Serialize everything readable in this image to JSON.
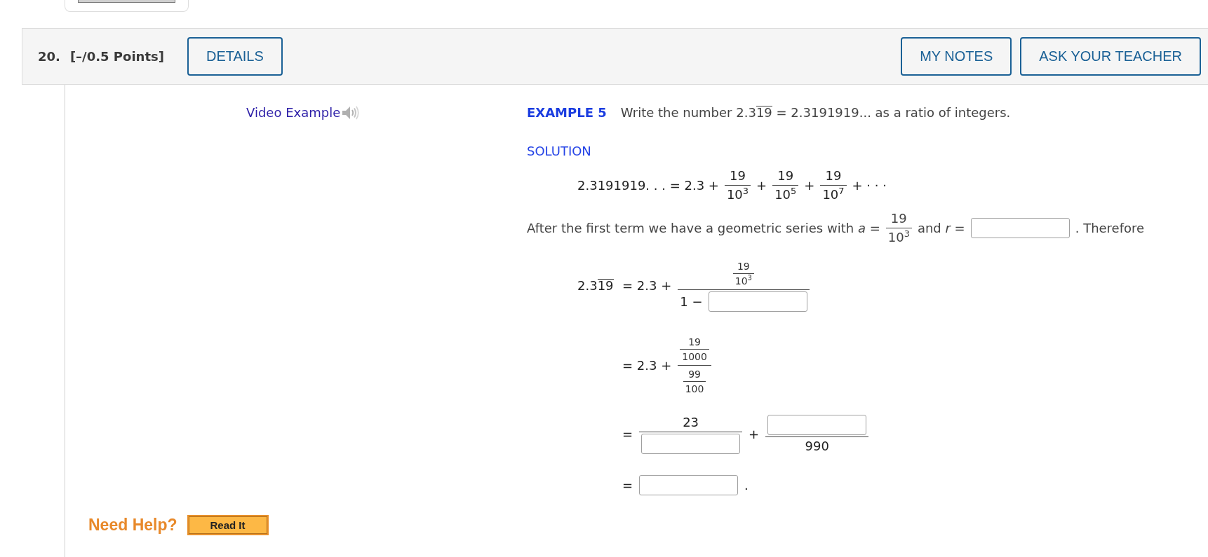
{
  "question": {
    "number": "20.",
    "points": "[–/0.5 Points]",
    "details_button": "DETAILS",
    "notes_button": "MY NOTES",
    "teacher_button": "ASK YOUR TEACHER"
  },
  "video_example": {
    "label": "Video Example"
  },
  "example": {
    "heading": "EXAMPLE 5",
    "prompt": [
      {
        "kind": "text",
        "text": "Write the number"
      },
      {
        "kind": "repeating",
        "fixed": "2.3",
        "repeating": "19"
      },
      {
        "kind": "text",
        "text": "= 2.3191919... as a ratio of integers."
      }
    ]
  },
  "solution": {
    "heading": "SOLUTION",
    "expansion": [
      {
        "kind": "text",
        "text": "2.3191919. . . = 2.3 +"
      },
      {
        "kind": "fraction",
        "numerator": [
          {
            "kind": "text",
            "text": "19"
          }
        ],
        "denominator": [
          {
            "kind": "text",
            "text": "10$^{3}$"
          }
        ]
      },
      {
        "kind": "text",
        "text": "+"
      },
      {
        "kind": "fraction",
        "numerator": [
          {
            "kind": "text",
            "text": "19"
          }
        ],
        "denominator": [
          {
            "kind": "text",
            "text": "10$^{5}$"
          }
        ]
      },
      {
        "kind": "text",
        "text": "+"
      },
      {
        "kind": "fraction",
        "numerator": [
          {
            "kind": "text",
            "text": "19"
          }
        ],
        "denominator": [
          {
            "kind": "text",
            "text": "10$^{7}$"
          }
        ]
      },
      {
        "kind": "text",
        "text": "+ · · ·"
      }
    ],
    "explanation": [
      {
        "kind": "text",
        "text": "After the first term we have a geometric series with *a* ="
      },
      {
        "kind": "fraction",
        "numerator": [
          {
            "kind": "text",
            "text": "19"
          }
        ],
        "denominator": [
          {
            "kind": "text",
            "text": "10$^{3}$"
          }
        ]
      },
      {
        "kind": "text",
        "text": "and *r* ="
      },
      {
        "kind": "input"
      },
      {
        "kind": "text",
        "text": ". Therefore"
      }
    ],
    "derivation": [
      {
        "lhs": [
          {
            "kind": "repeating",
            "fixed": "2.3",
            "repeating": "19"
          }
        ],
        "rhs": [
          {
            "kind": "text",
            "text": "= 2.3 +"
          },
          {
            "kind": "fraction",
            "numerator": [
              {
                "kind": "fraction",
                "numerator": [
                  {
                    "kind": "text",
                    "text": "19"
                  }
                ],
                "denominator": [
                  {
                    "kind": "text",
                    "text": "10$^{3}$"
                  }
                ]
              }
            ],
            "denominator": [
              {
                "kind": "text",
                "text": "1 −"
              },
              {
                "kind": "input"
              }
            ]
          }
        ]
      },
      {
        "rhs": [
          {
            "kind": "text",
            "text": "= 2.3 +"
          },
          {
            "kind": "fraction",
            "numerator": [
              {
                "kind": "fraction",
                "numerator": [
                  {
                    "kind": "text",
                    "text": "19"
                  }
                ],
                "denominator": [
                  {
                    "kind": "text",
                    "text": "1000"
                  }
                ]
              }
            ],
            "denominator": [
              {
                "kind": "fraction",
                "numerator": [
                  {
                    "kind": "text",
                    "text": "99"
                  }
                ],
                "denominator": [
                  {
                    "kind": "text",
                    "text": "100"
                  }
                ]
              }
            ]
          }
        ]
      },
      {
        "rhs": [
          {
            "kind": "text",
            "text": "="
          },
          {
            "kind": "fraction",
            "numerator": [
              {
                "kind": "text",
                "text": "23"
              }
            ],
            "denominator": [
              {
                "kind": "input"
              }
            ]
          },
          {
            "kind": "text",
            "text": "+"
          },
          {
            "kind": "fraction",
            "numerator": [
              {
                "kind": "input"
              }
            ],
            "denominator": [
              {
                "kind": "text",
                "text": "990"
              }
            ]
          }
        ]
      },
      {
        "rhs": [
          {
            "kind": "text",
            "text": "="
          },
          {
            "kind": "input"
          },
          {
            "kind": "text",
            "text": "."
          }
        ]
      }
    ]
  },
  "help": {
    "label": "Need Help?",
    "read_button": "Read It"
  }
}
